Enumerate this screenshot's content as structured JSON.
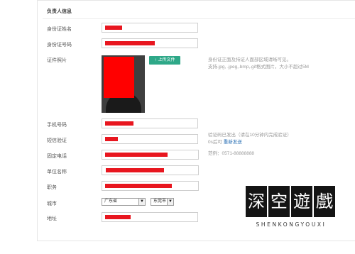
{
  "section_title": "负责人信息",
  "fields": {
    "name": {
      "label": "身份证姓名"
    },
    "id_number": {
      "label": "身份证号码"
    },
    "id_photo": {
      "label": "证件照片"
    },
    "mobile": {
      "label": "手机号码"
    },
    "sms_code": {
      "label": "短信验证"
    },
    "landline": {
      "label": "固定电话"
    },
    "company": {
      "label": "单位名称"
    },
    "position": {
      "label": "职务"
    },
    "city": {
      "label": "城市"
    },
    "address": {
      "label": "地址"
    }
  },
  "upload": {
    "button_label": "上传文件",
    "icon": "upload-arrow-icon"
  },
  "photo_hint": {
    "line1": "身份证正面及持证人面部区域请晰可见。",
    "line2": "支持.jpg, .jpeg,.bmp,.gif格式图片，大小不超过5M"
  },
  "sms_hint": {
    "line1": "验证码已发出（请在10分钟内完成验证）",
    "countdown": "0s后可",
    "resend_link": "重新发送"
  },
  "landline_hint": "范例：0571-88888888",
  "city_select": {
    "province": "广东省",
    "city": "东莞市"
  },
  "watermark": {
    "chars": [
      "深",
      "空",
      "遊",
      "戲"
    ],
    "subtitle": "SHENKONGYOUXI"
  },
  "colors": {
    "redaction": "#e8161f",
    "upload_button": "#2ea888",
    "link": "#2b71b5"
  }
}
